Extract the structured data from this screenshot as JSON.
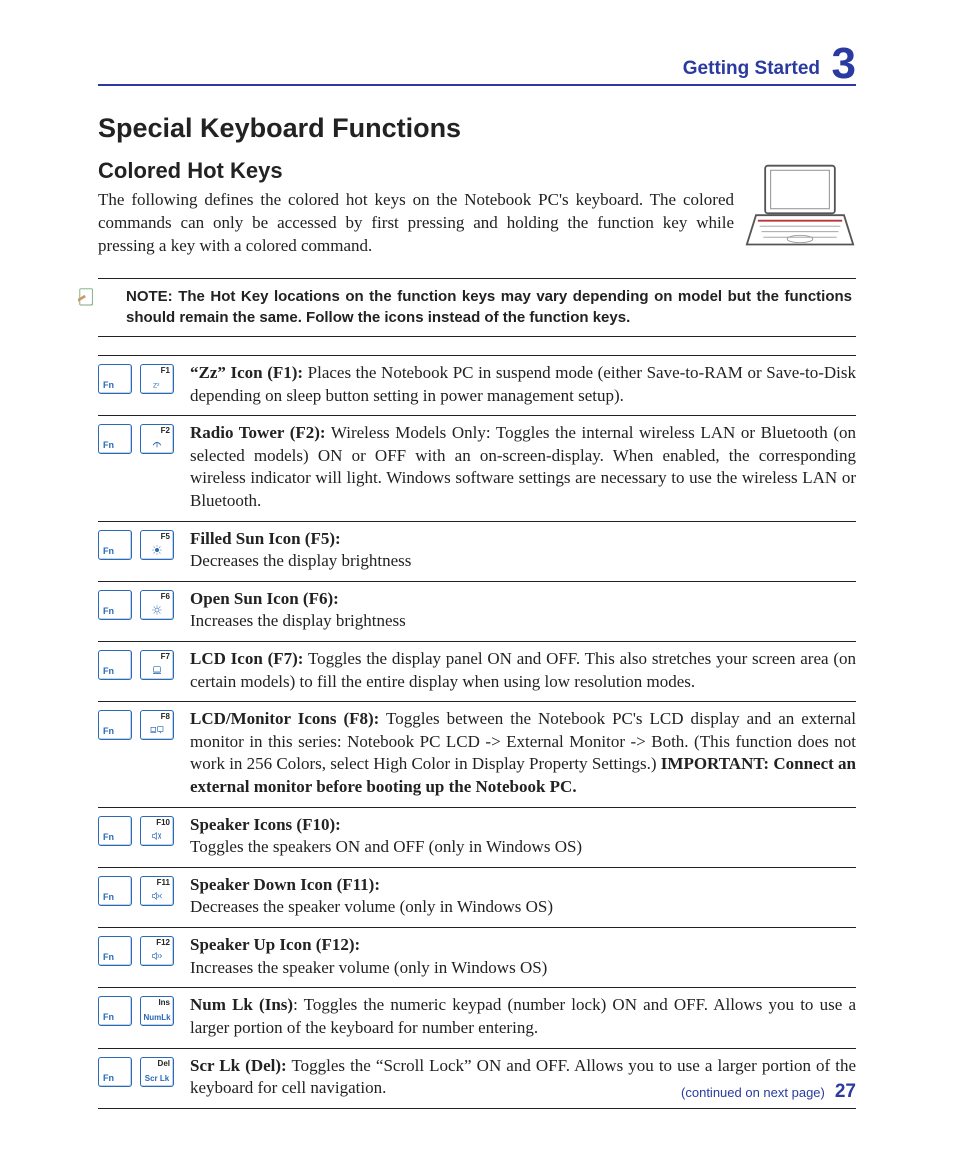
{
  "header": {
    "section": "Getting Started",
    "chapter": "3"
  },
  "title": "Special Keyboard Functions",
  "subtitle": "Colored Hot Keys",
  "intro": "The following defines the colored hot keys on the Notebook PC's keyboard. The colored commands can only be accessed by first pressing and holding the function key while pressing a key with a colored command.",
  "note": "NOTE: The Hot Key locations on the function keys may vary depending on model but the functions should remain the same. Follow the icons instead of the function keys.",
  "rows": [
    {
      "top": "F1",
      "head": "“Zz” Icon (F1):",
      "body": " Places the Notebook PC in suspend mode (either Save-to-RAM or Save-to-Disk depending on sleep button setting in power management setup)."
    },
    {
      "top": "F2",
      "head": "Radio Tower (F2):",
      "body": " Wireless Models Only: Toggles the internal wireless LAN or Bluetooth (on selected models) ON or OFF with an on-screen-display. When enabled, the corresponding wireless indicator will light. Windows software settings are necessary to use the wireless LAN or Bluetooth."
    },
    {
      "top": "F5",
      "head": "Filled Sun Icon (F5):",
      "body": "Decreases the display brightness",
      "br": true
    },
    {
      "top": "F6",
      "head": "Open Sun Icon (F6):",
      "body": "Increases the display brightness",
      "br": true
    },
    {
      "top": "F7",
      "head": "LCD Icon (F7):",
      "body": " Toggles the display panel ON and OFF. This also stretches your screen area (on certain models) to fill the entire display when using low resolution modes."
    },
    {
      "top": "F8",
      "head": "LCD/Monitor Icons (F8):",
      "body": " Toggles between the Notebook PC's LCD display and an external monitor in this series: Notebook PC LCD -> External Monitor -> Both. (This function does not work in 256 Colors, select High Color in Display Property Settings.) ",
      "tail_head": "IMPORTANT: Connect an external monitor before booting up the Notebook PC."
    },
    {
      "top": "F10",
      "head": "Speaker Icons (F10):",
      "body": "Toggles the speakers ON and OFF (only in Windows OS)",
      "br": true
    },
    {
      "top": "F11",
      "head": "Speaker Down Icon (F11):",
      "body": "Decreases the speaker volume (only in Windows OS)",
      "br": true
    },
    {
      "top": "F12",
      "head": "Speaker Up Icon (F12):",
      "body": "Increases the speaker volume (only in Windows OS)",
      "br": true
    },
    {
      "top": "Ins",
      "bot": "NumLk",
      "head": "Num Lk (Ins)",
      "body": ": Toggles the numeric keypad (number lock) ON and OFF. Allows you to use a larger portion of the keyboard for number entering."
    },
    {
      "top": "Del",
      "bot": "Scr Lk",
      "head": "Scr Lk (Del):",
      "body": " Toggles the “Scroll Lock” ON and OFF. Allows you to use a larger portion of the keyboard for cell navigation."
    }
  ],
  "footer": {
    "continued": "(continued on next page)",
    "page": "27"
  }
}
